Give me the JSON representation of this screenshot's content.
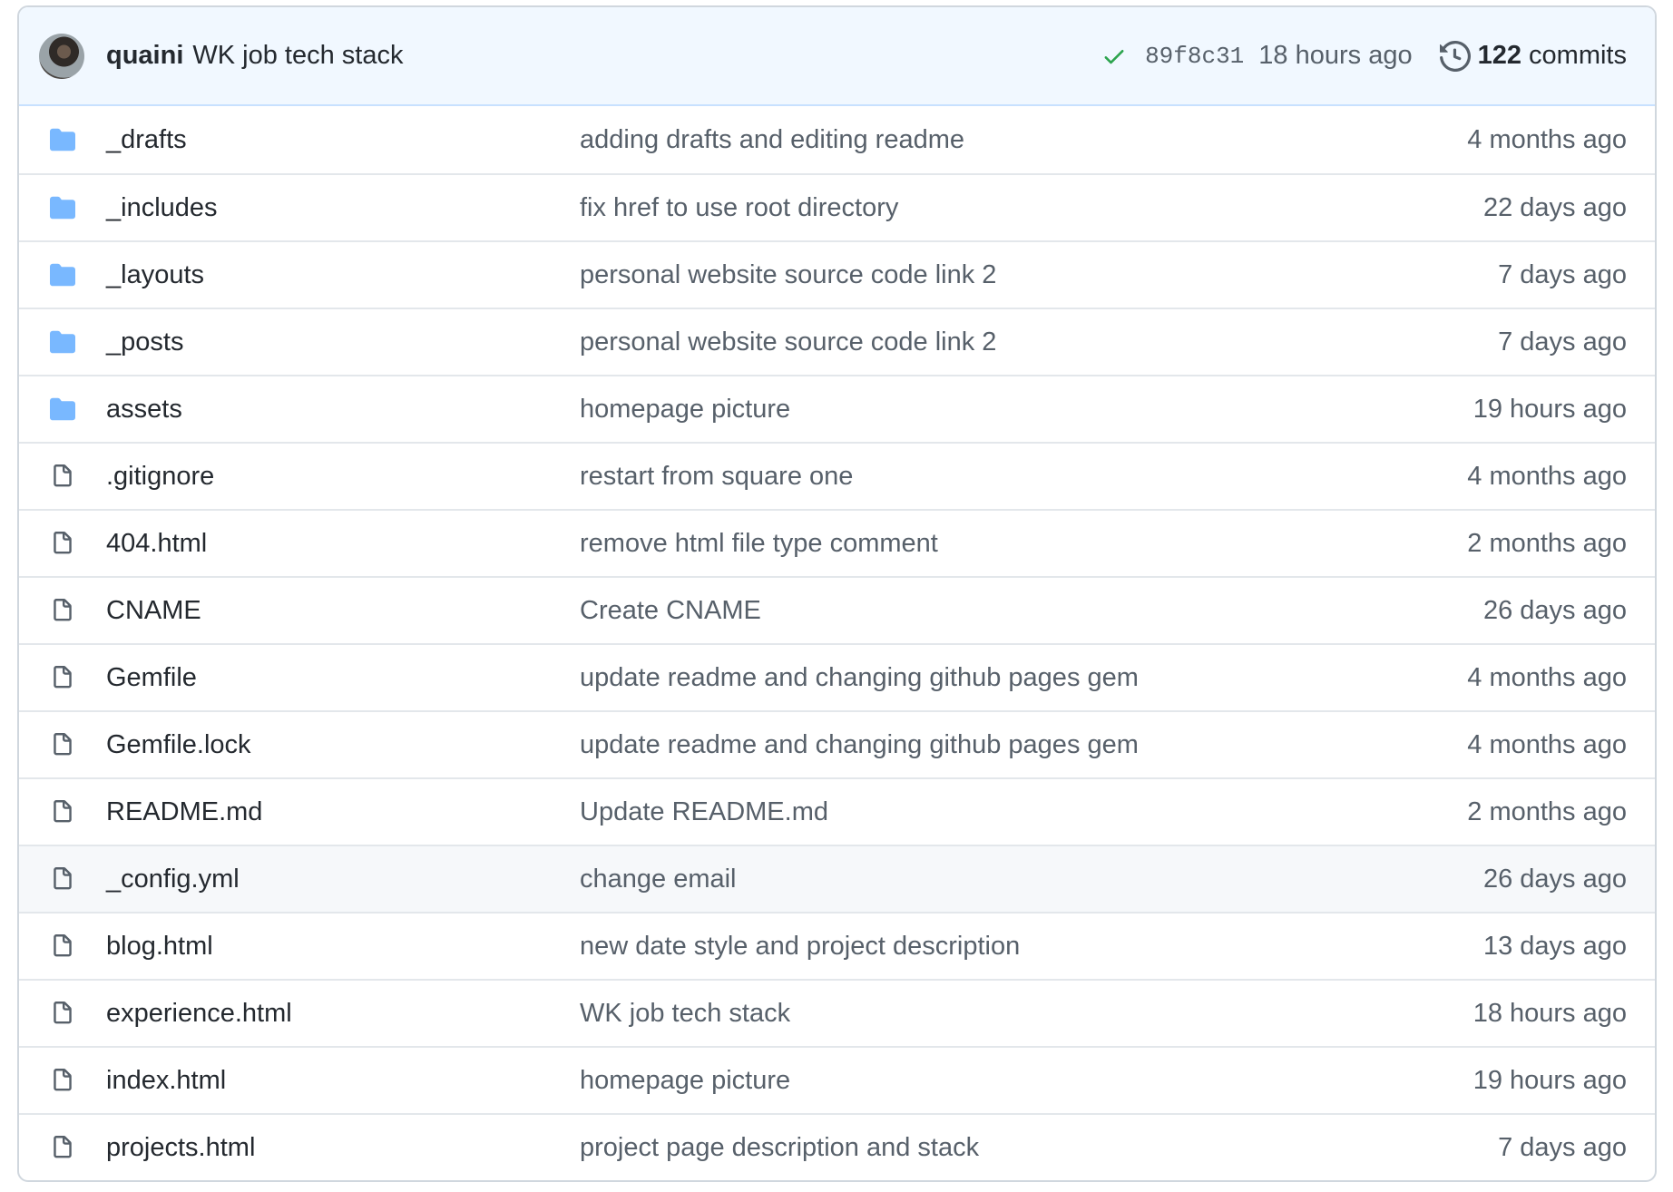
{
  "latest_commit": {
    "author": "quaini",
    "message": "WK job tech stack",
    "sha": "89f8c31",
    "age": "18 hours ago",
    "commit_count": "122",
    "commit_count_label": "commits",
    "check_color": "#2da44e"
  },
  "files": [
    {
      "type": "folder",
      "icon": "folder-icon",
      "name": "_drafts",
      "message": "adding drafts and editing readme",
      "age": "4 months ago"
    },
    {
      "type": "folder",
      "icon": "folder-icon",
      "name": "_includes",
      "message": "fix href to use root directory",
      "age": "22 days ago"
    },
    {
      "type": "folder",
      "icon": "folder-icon",
      "name": "_layouts",
      "message": "personal website source code link 2",
      "age": "7 days ago"
    },
    {
      "type": "folder",
      "icon": "folder-icon",
      "name": "_posts",
      "message": "personal website source code link 2",
      "age": "7 days ago"
    },
    {
      "type": "folder",
      "icon": "folder-icon",
      "name": "assets",
      "message": "homepage picture",
      "age": "19 hours ago"
    },
    {
      "type": "file",
      "icon": "file-icon",
      "name": ".gitignore",
      "message": "restart from square one",
      "age": "4 months ago"
    },
    {
      "type": "file",
      "icon": "file-icon",
      "name": "404.html",
      "message": "remove html file type comment",
      "age": "2 months ago"
    },
    {
      "type": "file",
      "icon": "file-icon",
      "name": "CNAME",
      "message": "Create CNAME",
      "age": "26 days ago"
    },
    {
      "type": "file",
      "icon": "file-icon",
      "name": "Gemfile",
      "message": "update readme and changing github pages gem",
      "age": "4 months ago"
    },
    {
      "type": "file",
      "icon": "file-icon",
      "name": "Gemfile.lock",
      "message": "update readme and changing github pages gem",
      "age": "4 months ago"
    },
    {
      "type": "file",
      "icon": "file-icon",
      "name": "README.md",
      "message": "Update README.md",
      "age": "2 months ago"
    },
    {
      "type": "file",
      "icon": "file-icon",
      "name": "_config.yml",
      "message": "change email",
      "age": "26 days ago"
    },
    {
      "type": "file",
      "icon": "file-icon",
      "name": "blog.html",
      "message": "new date style and project description",
      "age": "13 days ago"
    },
    {
      "type": "file",
      "icon": "file-icon",
      "name": "experience.html",
      "message": "WK job tech stack",
      "age": "18 hours ago"
    },
    {
      "type": "file",
      "icon": "file-icon",
      "name": "index.html",
      "message": "homepage picture",
      "age": "19 hours ago"
    },
    {
      "type": "file",
      "icon": "file-icon",
      "name": "projects.html",
      "message": "project page description and stack",
      "age": "7 days ago"
    }
  ],
  "colors": {
    "folder": "#79b8ff",
    "file_outline": "#57606a",
    "header_bg": "#f1f8ff"
  }
}
